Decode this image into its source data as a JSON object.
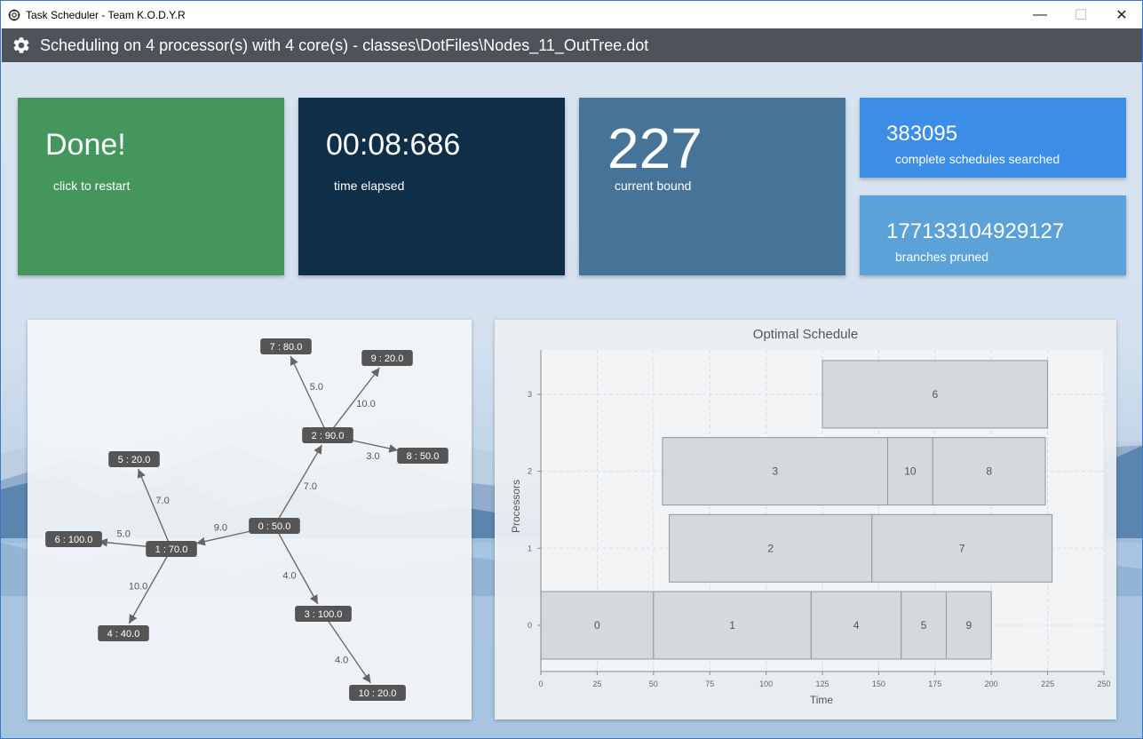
{
  "window": {
    "title": "Task Scheduler - Team K.O.D.Y.R",
    "controls": {
      "minimize": "—",
      "maximize": "☐",
      "close": "✕"
    }
  },
  "header": {
    "icon": "gear-icon",
    "title": "Scheduling on 4 processor(s) with 4 core(s) - classes\\DotFiles\\Nodes_11_OutTree.dot"
  },
  "stats": {
    "status": {
      "value": "Done!",
      "label": "click to restart",
      "color": "#44965c"
    },
    "time": {
      "value": "00:08:686",
      "label": "time elapsed",
      "color": "#0f2e47"
    },
    "bound": {
      "value": "227",
      "label": "current bound",
      "color": "#467499"
    },
    "complete": {
      "value": "383095",
      "label": "complete schedules searched",
      "color": "#3b8de6"
    },
    "pruned": {
      "value": "177133104929127",
      "label": "branches pruned",
      "color": "#5ba2d8"
    }
  },
  "graph": {
    "nodes": [
      {
        "id": "0",
        "label": "0 : 50.0"
      },
      {
        "id": "1",
        "label": "1 : 70.0"
      },
      {
        "id": "2",
        "label": "2 : 90.0"
      },
      {
        "id": "3",
        "label": "3 : 100.0"
      },
      {
        "id": "4",
        "label": "4 : 40.0"
      },
      {
        "id": "5",
        "label": "5 : 20.0"
      },
      {
        "id": "6",
        "label": "6 : 100.0"
      },
      {
        "id": "7",
        "label": "7 : 80.0"
      },
      {
        "id": "8",
        "label": "8 : 50.0"
      },
      {
        "id": "9",
        "label": "9 : 20.0"
      },
      {
        "id": "10",
        "label": "10 : 20.0"
      }
    ],
    "edges": [
      {
        "from": "0",
        "to": "1",
        "weight": "9.0"
      },
      {
        "from": "0",
        "to": "2",
        "weight": "7.0"
      },
      {
        "from": "0",
        "to": "3",
        "weight": "4.0"
      },
      {
        "from": "1",
        "to": "4",
        "weight": "10.0"
      },
      {
        "from": "1",
        "to": "5",
        "weight": "7.0"
      },
      {
        "from": "1",
        "to": "6",
        "weight": "5.0"
      },
      {
        "from": "2",
        "to": "7",
        "weight": "5.0"
      },
      {
        "from": "2",
        "to": "8",
        "weight": "3.0"
      },
      {
        "from": "2",
        "to": "9",
        "weight": "10.0"
      },
      {
        "from": "3",
        "to": "10",
        "weight": "4.0"
      }
    ]
  },
  "chart_data": {
    "type": "gantt",
    "title": "Optimal Schedule",
    "xlabel": "Time",
    "ylabel": "Processors",
    "xlim": [
      0,
      250
    ],
    "x_ticks": [
      0,
      25,
      50,
      75,
      100,
      125,
      150,
      175,
      200,
      225,
      250
    ],
    "categories": [
      "0",
      "1",
      "2",
      "3"
    ],
    "grid": true,
    "tasks": [
      {
        "name": "0",
        "processor": 0,
        "start": 0,
        "end": 50
      },
      {
        "name": "1",
        "processor": 0,
        "start": 50,
        "end": 120
      },
      {
        "name": "4",
        "processor": 0,
        "start": 120,
        "end": 160
      },
      {
        "name": "5",
        "processor": 0,
        "start": 160,
        "end": 180
      },
      {
        "name": "9",
        "processor": 0,
        "start": 180,
        "end": 200
      },
      {
        "name": "2",
        "processor": 1,
        "start": 57,
        "end": 147
      },
      {
        "name": "7",
        "processor": 1,
        "start": 147,
        "end": 227
      },
      {
        "name": "3",
        "processor": 2,
        "start": 54,
        "end": 154
      },
      {
        "name": "10",
        "processor": 2,
        "start": 154,
        "end": 174
      },
      {
        "name": "8",
        "processor": 2,
        "start": 174,
        "end": 224
      },
      {
        "name": "6",
        "processor": 3,
        "start": 125,
        "end": 225
      }
    ]
  }
}
